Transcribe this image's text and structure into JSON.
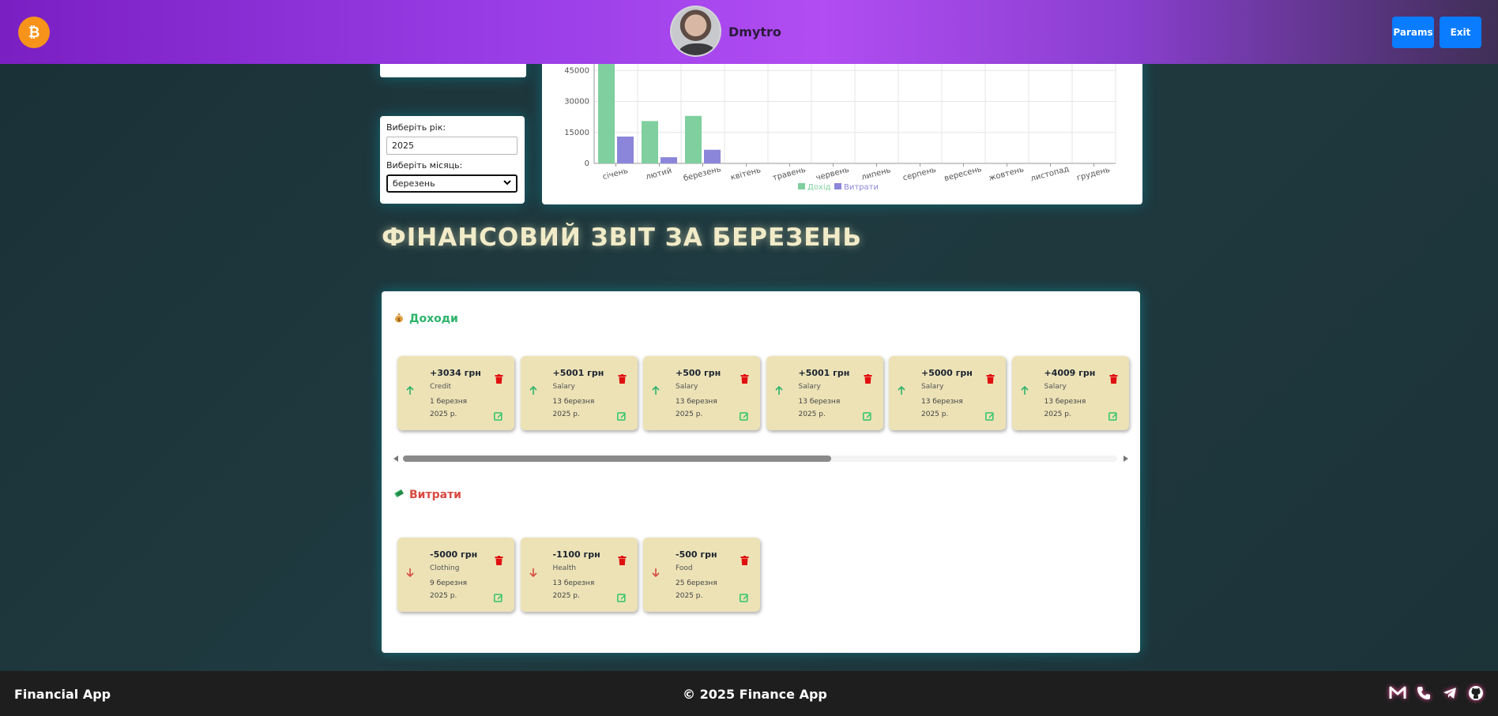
{
  "header": {
    "logo_icon": "bitcoin-icon",
    "username": "Dmytro",
    "params_label": "Params",
    "exit_label": "Exit"
  },
  "filters": {
    "year_label": "Виберіть рік:",
    "year_value": "2025",
    "month_label": "Виберіть місяць:",
    "month_value": "березень"
  },
  "chart_data": {
    "type": "bar",
    "categories": [
      "січень",
      "лютий",
      "березень",
      "квітень",
      "травень",
      "червень",
      "липень",
      "серпень",
      "вересень",
      "жовтень",
      "листопад",
      "грудень"
    ],
    "series": [
      {
        "name": "Дохід",
        "color": "#7fcf9f",
        "values": [
          60000,
          20500,
          23000,
          0,
          0,
          0,
          0,
          0,
          0,
          0,
          0,
          0
        ]
      },
      {
        "name": "Витрати",
        "color": "#8b86d9",
        "values": [
          13000,
          3000,
          6600,
          0,
          0,
          0,
          0,
          0,
          0,
          0,
          0,
          0
        ]
      }
    ],
    "yticks": [
      0,
      15000,
      30000,
      45000
    ],
    "ylim": [
      0,
      60000
    ],
    "legend": "bottom-center"
  },
  "report": {
    "title": "ФІНАНСОВИЙ ЗВІТ ЗА БЕРЕЗЕНЬ",
    "income_title": "Доходи",
    "income_icon": "money-bag-icon",
    "expense_title": "Витрати",
    "expense_icon": "money-wings-icon",
    "incomes": [
      {
        "amount": "+3034 грн",
        "category": "Credit",
        "date_line1": "1 березня",
        "date_line2": "2025 р."
      },
      {
        "amount": "+5001 грн",
        "category": "Salary",
        "date_line1": "13 березня",
        "date_line2": "2025 р."
      },
      {
        "amount": "+500 грн",
        "category": "Salary",
        "date_line1": "13 березня",
        "date_line2": "2025 р."
      },
      {
        "amount": "+5001 грн",
        "category": "Salary",
        "date_line1": "13 березня",
        "date_line2": "2025 р."
      },
      {
        "amount": "+5000 грн",
        "category": "Salary",
        "date_line1": "13 березня",
        "date_line2": "2025 р."
      },
      {
        "amount": "+4009 грн",
        "category": "Salary",
        "date_line1": "13 березня",
        "date_line2": "2025 р."
      }
    ],
    "expenses": [
      {
        "amount": "-5000 грн",
        "category": "Clothing",
        "date_line1": "9 березня",
        "date_line2": "2025 р."
      },
      {
        "amount": "-1100 грн",
        "category": "Health",
        "date_line1": "13 березня",
        "date_line2": "2025 р."
      },
      {
        "amount": "-500 грн",
        "category": "Food",
        "date_line1": "25 березня",
        "date_line2": "2025 р."
      }
    ],
    "scroll_position": 0.6,
    "colors": {
      "income": "#2db36b",
      "expense": "#d84a40",
      "card_bg": "#ece2b6",
      "trash": "#e01010",
      "edit": "#2fc56a"
    }
  },
  "footer": {
    "brand": "Financial App",
    "copyright": "© 2025 Finance App",
    "icons": [
      "gmail-icon",
      "phone-icon",
      "telegram-icon",
      "github-icon"
    ]
  }
}
